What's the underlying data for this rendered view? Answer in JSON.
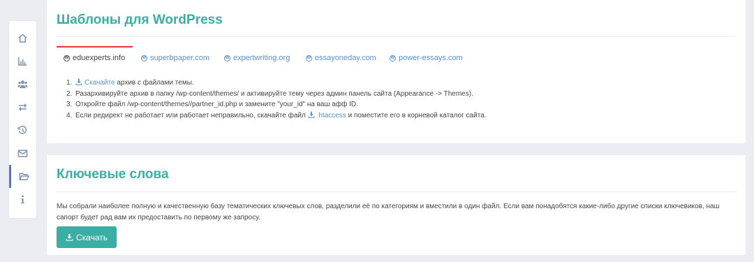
{
  "sidebar": {
    "items": [
      {
        "icon": "home-icon"
      },
      {
        "icon": "bar-chart-icon"
      },
      {
        "icon": "users-icon"
      },
      {
        "icon": "exchange-icon"
      },
      {
        "icon": "history-icon"
      },
      {
        "icon": "envelope-icon"
      },
      {
        "icon": "folder-open-icon",
        "active": true
      },
      {
        "icon": "info-icon"
      }
    ]
  },
  "wordpress": {
    "title": "Шаблоны для WordPress",
    "tabs": [
      {
        "label": "eduexperts.info",
        "active": true
      },
      {
        "label": "superbpaper.com"
      },
      {
        "label": "expertwriting.org"
      },
      {
        "label": "essayoneday.com"
      },
      {
        "label": "power-essays.com"
      }
    ],
    "steps": {
      "s1_num": "1.",
      "s1_link": "Скачайте",
      "s1_text": " архив с файлами темы.",
      "s2_num": "2.",
      "s2_text": "Разархивируйте архив в папку /wp-content/themes/ и активируйте тему через админ панель сайта (Appearance -> Themes).",
      "s3_num": "3.",
      "s3_text": "Откройте файл /wp-content/themes//partner_id.php и замените \"your_id\" на ваш афф ID.",
      "s4_num": "4.",
      "s4_pre": "Если редирект не работает или работает неправильно, скачайте файл ",
      "s4_link": ".htaccess",
      "s4_post": " и поместите его в корневой каталог сайта."
    }
  },
  "keywords": {
    "title": "Ключевые слова",
    "text": "Мы собрали наиболее полную и качественную базу тематических ключевых слов, разделили её по категориям и вместили в один файл. Если вам понадобятся какие-либо другие списки ключевиков, наш сапорт будет рад вам их предоставить по первому же запросу.",
    "button": "Скачать"
  },
  "colors": {
    "accent": "#3aaea4",
    "link": "#5a8fd0",
    "tab_active_underline": "#e0383e"
  }
}
